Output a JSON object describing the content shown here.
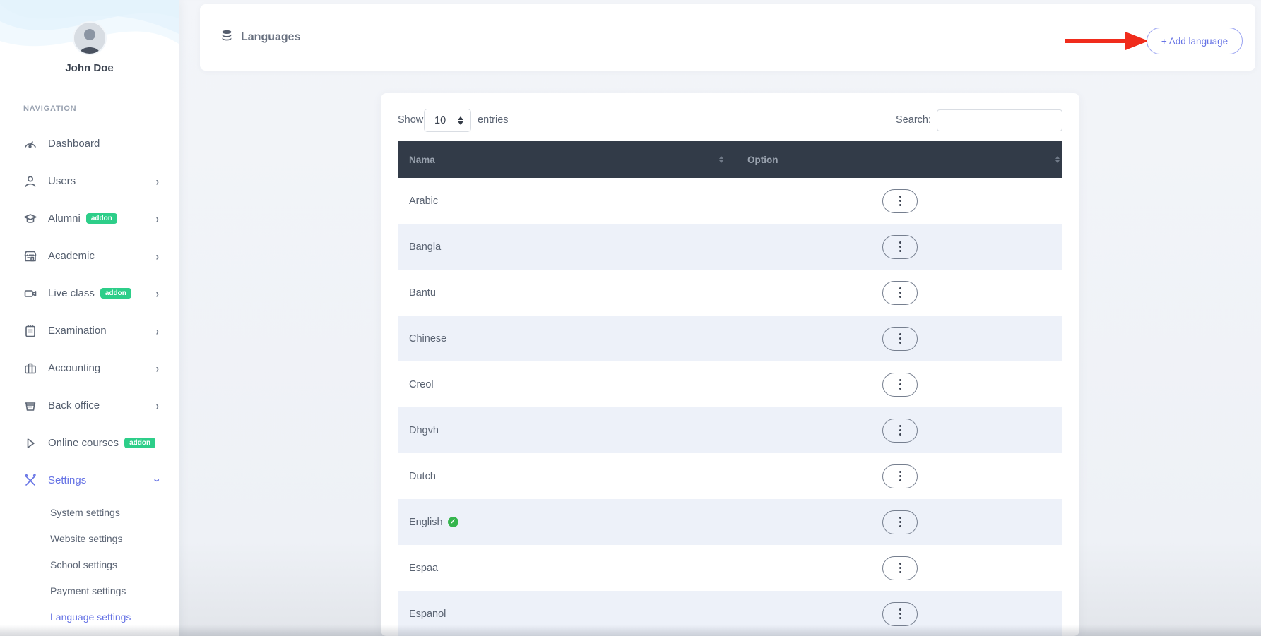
{
  "sidebar": {
    "profile_name": "John Doe",
    "nav_label": "NAVIGATION",
    "items": [
      {
        "label": "Dashboard"
      },
      {
        "label": "Users"
      },
      {
        "label": "Alumni",
        "badge": "addon"
      },
      {
        "label": "Academic"
      },
      {
        "label": "Live class",
        "badge": "addon"
      },
      {
        "label": "Examination"
      },
      {
        "label": "Accounting"
      },
      {
        "label": "Back office"
      },
      {
        "label": "Online courses",
        "badge": "addon"
      },
      {
        "label": "Settings",
        "active": true
      }
    ],
    "settings_children": [
      {
        "label": "System settings"
      },
      {
        "label": "Website settings"
      },
      {
        "label": "School settings"
      },
      {
        "label": "Payment settings"
      },
      {
        "label": "Language settings",
        "active": true
      }
    ]
  },
  "header": {
    "title": "Languages",
    "add_button_label": "+ Add language"
  },
  "table_card": {
    "show_label": "Show",
    "entries_per_page": "10",
    "entries_label": "entries",
    "search_label": "Search:",
    "search_value": "",
    "columns": [
      "Nama",
      "Option"
    ],
    "rows": [
      {
        "name": "Arabic"
      },
      {
        "name": "Bangla"
      },
      {
        "name": "Bantu"
      },
      {
        "name": "Chinese"
      },
      {
        "name": "Creol"
      },
      {
        "name": "Dhgvh"
      },
      {
        "name": "Dutch"
      },
      {
        "name": "English",
        "verified": true
      },
      {
        "name": "Espaa"
      },
      {
        "name": "Espanol"
      }
    ]
  },
  "icons": {
    "title_icon": "database-icon",
    "check_glyph": "✓"
  },
  "colors": {
    "accent_indigo": "#6673e5",
    "badge_green": "#2dce89",
    "table_header_bg": "#323b48",
    "stripe_row": "#edf1f9",
    "annotation_red": "#f02c1c",
    "verified_green": "#35b54d"
  }
}
